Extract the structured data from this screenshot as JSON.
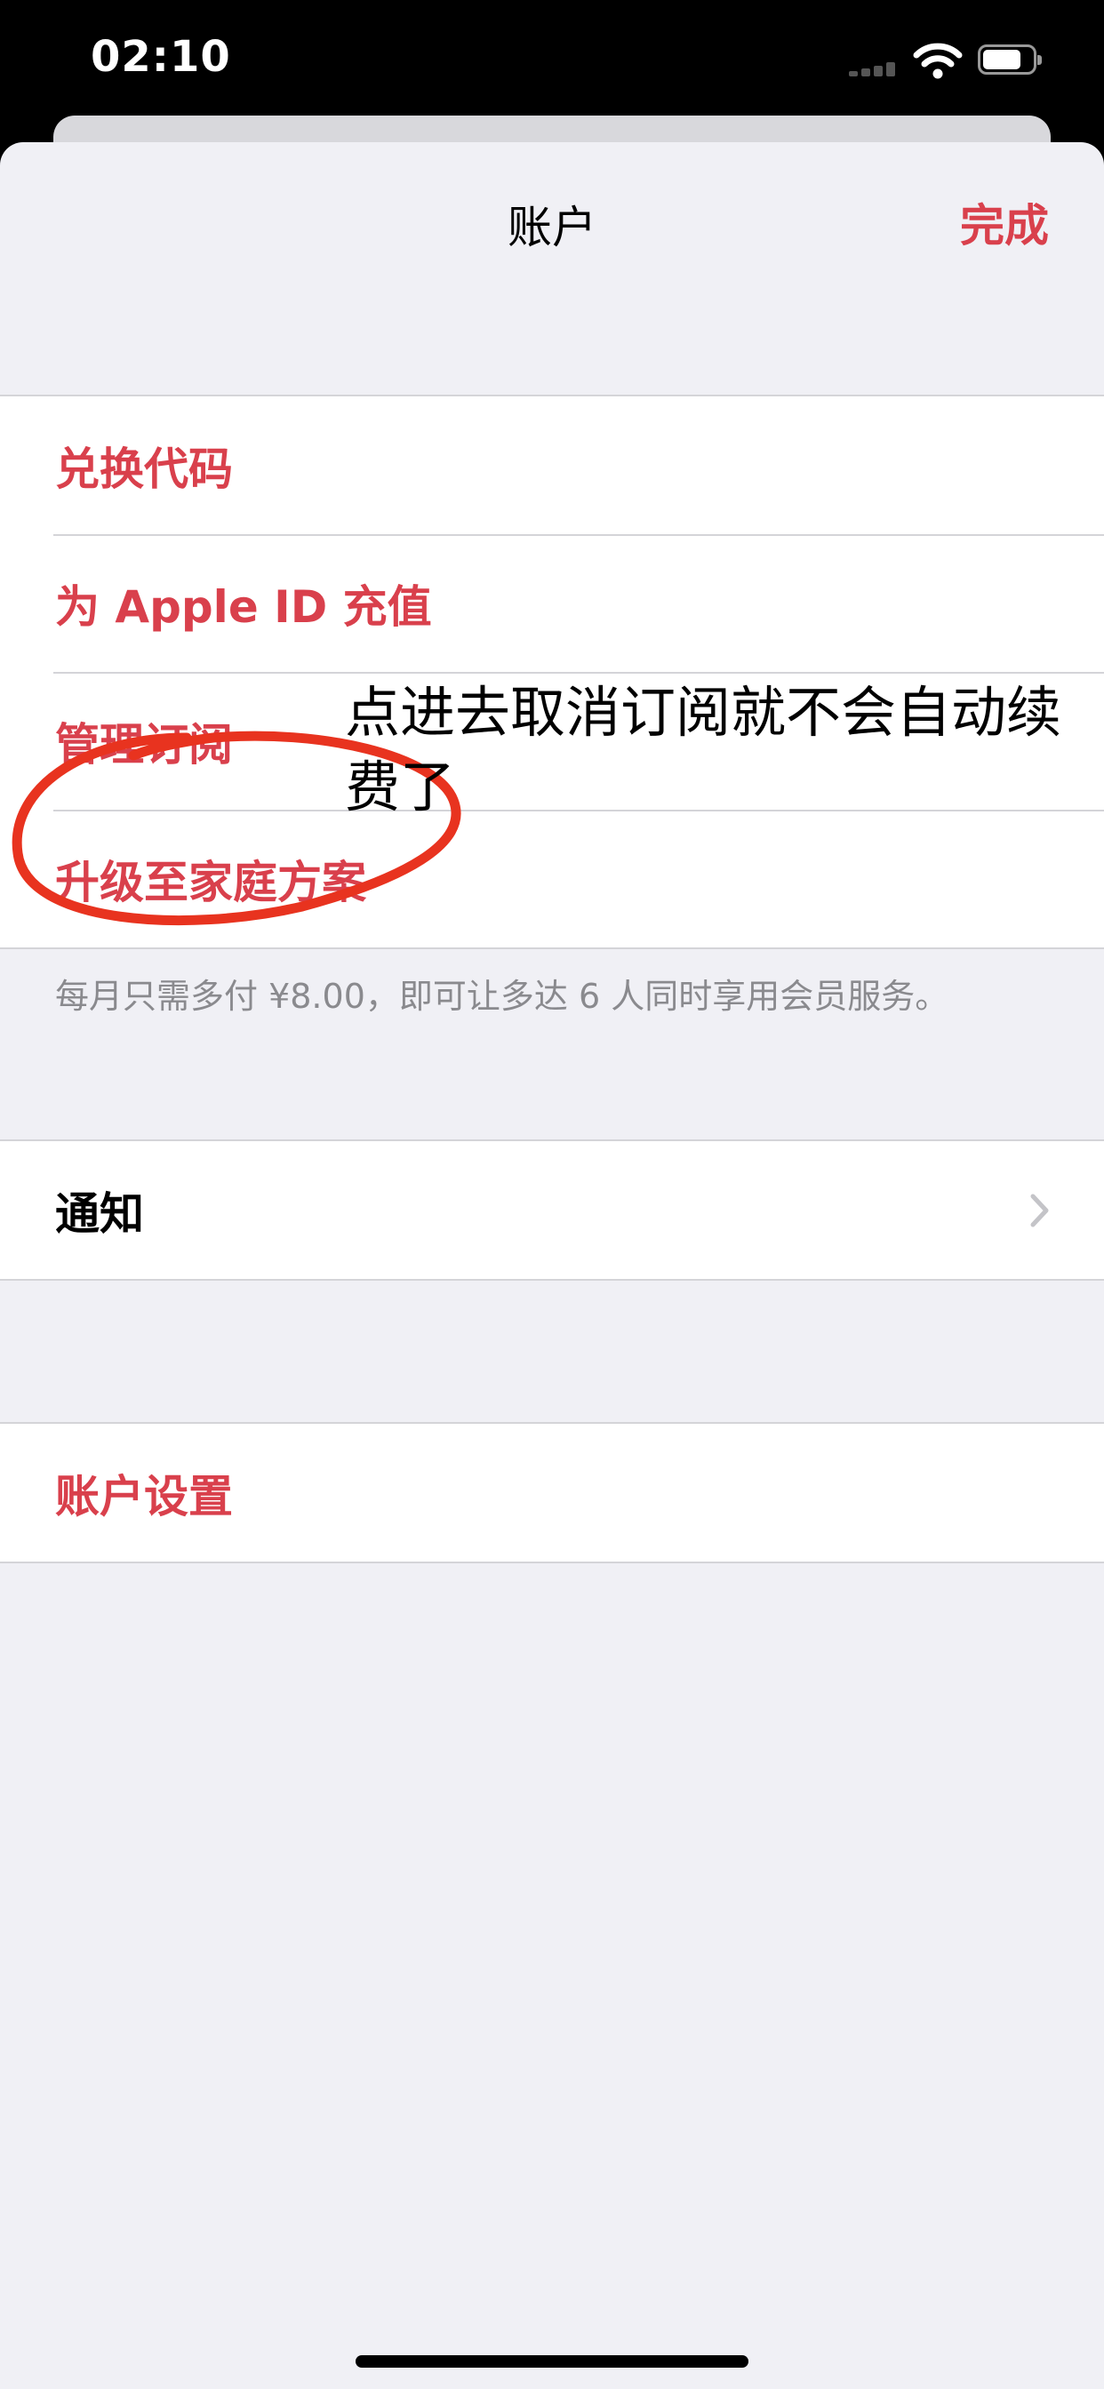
{
  "status_bar": {
    "time": "02:10"
  },
  "nav": {
    "title": "账户",
    "done_label": "完成"
  },
  "group1": {
    "items": [
      {
        "label": "兑换代码"
      },
      {
        "label": "为 Apple ID 充值"
      },
      {
        "label": "管理订阅"
      },
      {
        "label": "升级至家庭方案"
      }
    ],
    "footer": "每月只需多付 ¥8.00，即可让多达 6 人同时享用会员服务。"
  },
  "group2": {
    "items": [
      {
        "label": "通知"
      }
    ]
  },
  "group3": {
    "items": [
      {
        "label": "账户设置"
      }
    ]
  },
  "annotation": {
    "text": "点进去取消订阅就不会自动续费了"
  },
  "colors": {
    "accent": "#d9404c",
    "annotation": "#e8331f",
    "background": "#f0f0f5"
  }
}
